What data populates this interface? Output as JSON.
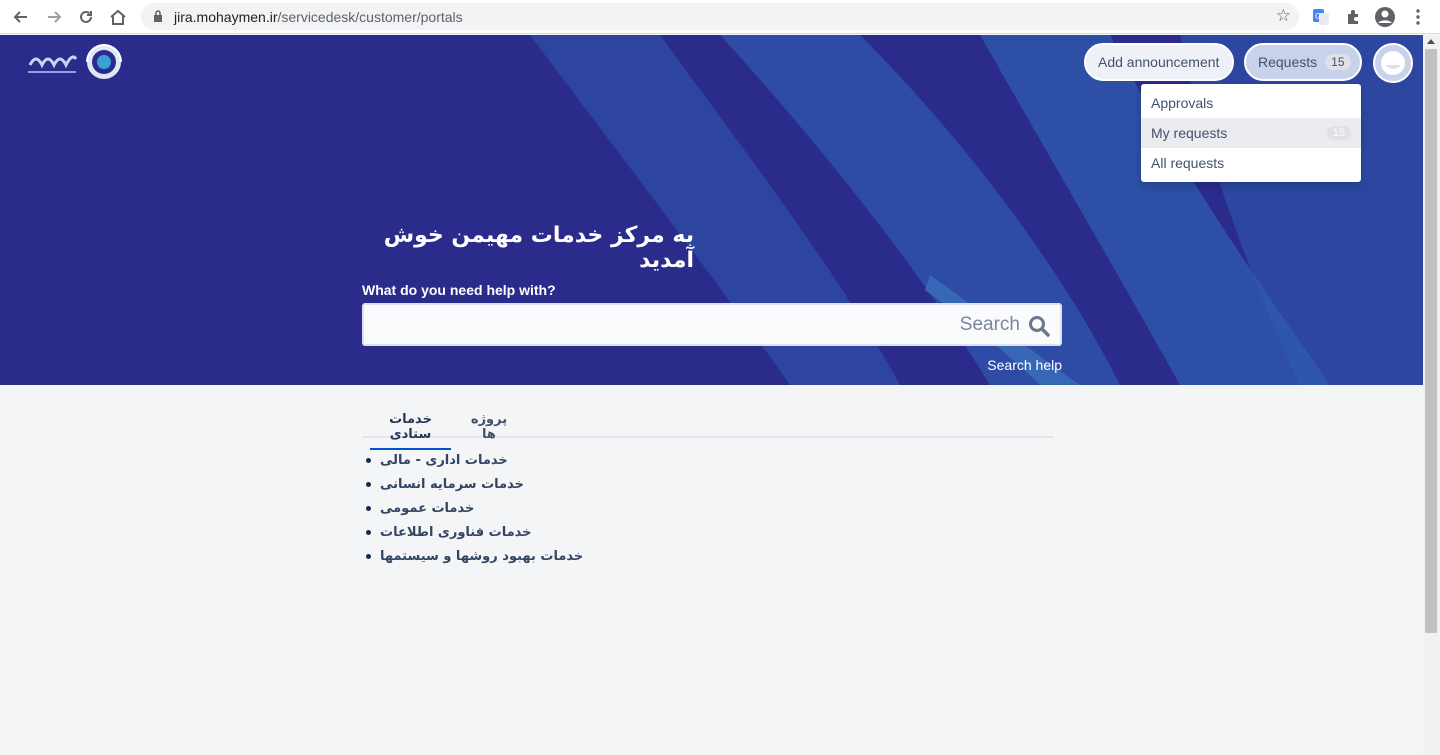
{
  "browser": {
    "url_host": "jira.mohaymen.ir",
    "url_path": "/servicedesk/customer/portals"
  },
  "header": {
    "announce_label": "Add announcement",
    "requests_label": "Requests",
    "requests_count": "15"
  },
  "dropdown": {
    "items": [
      {
        "label": "Approvals",
        "count": ""
      },
      {
        "label": "My requests",
        "count": "15"
      },
      {
        "label": "All requests",
        "count": ""
      }
    ]
  },
  "hero": {
    "welcome": "به مرکز خدمات مهیمن خوش آمدید",
    "help_label": "What do you need help with?",
    "search_placeholder": "Search",
    "search_help": "Search help"
  },
  "tabs": [
    {
      "label": "خدمات ستادی",
      "active": true
    },
    {
      "label": "پروژه ها",
      "active": false
    }
  ],
  "services": [
    "خدمات اداری - مالی",
    "خدمات سرمایه انسانی",
    "خدمات عمومی",
    "خدمات فناوری اطلاعات",
    "خدمات بهبود روشها و سیستمها"
  ],
  "colors": {
    "banner": "#2b2b8c",
    "banner_stripe": "#2f5fb0",
    "link": "#344563",
    "tab_active": "#0052cc"
  }
}
